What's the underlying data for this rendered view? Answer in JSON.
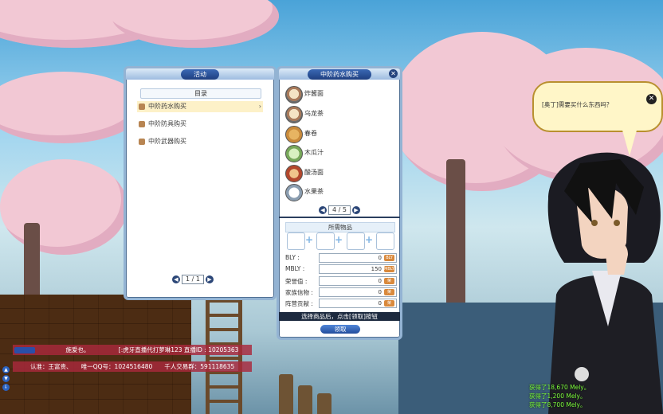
{
  "activity_panel": {
    "title": "活动",
    "catalog_title": "目录",
    "items": [
      "中阶药水购买",
      "中阶防具购买",
      "中阶武器购买"
    ],
    "page": "1 / 1"
  },
  "shop_panel": {
    "title": "中阶药水购买",
    "items": [
      "炸酱面",
      "乌龙茶",
      "春卷",
      "木瓜汁",
      "酸汤面",
      "水果茶"
    ],
    "page": "4 / 5",
    "required_title": "所需物品",
    "fields": [
      {
        "label": "BLY :",
        "value": "0",
        "currency": "BLY"
      },
      {
        "label": "MBLY :",
        "value": "150",
        "currency": "MBLY"
      },
      {
        "label": "荣誉值 :",
        "value": "0",
        "currency": "荣"
      },
      {
        "label": "家族信物 :",
        "value": "0",
        "currency": "荣"
      },
      {
        "label": "阵营贡献 :",
        "value": "0",
        "currency": "荣"
      }
    ],
    "hint": "选择商品后，点击[领取]按钮",
    "claim_button": "领取"
  },
  "npc": {
    "speech": "[奥丁]需要买什么东西吗？"
  },
  "chat": {
    "line1_name": "施爱也。",
    "line1_text": "[:虎牙直播代打萝琳123 直播ID : 10205363",
    "line2_text": "认准：王富贵、　　唯一QQ号：1024516480　　千人交易群：591118635"
  },
  "loot_log": [
    "获得了18,670 Mely。",
    "获得了1,200 Mely。",
    "获得了8,700 Mely。"
  ],
  "colors": {
    "panel_border": "#93b3d3",
    "title_pill": "#1f3f80",
    "chat_bg": "#aa283c"
  }
}
